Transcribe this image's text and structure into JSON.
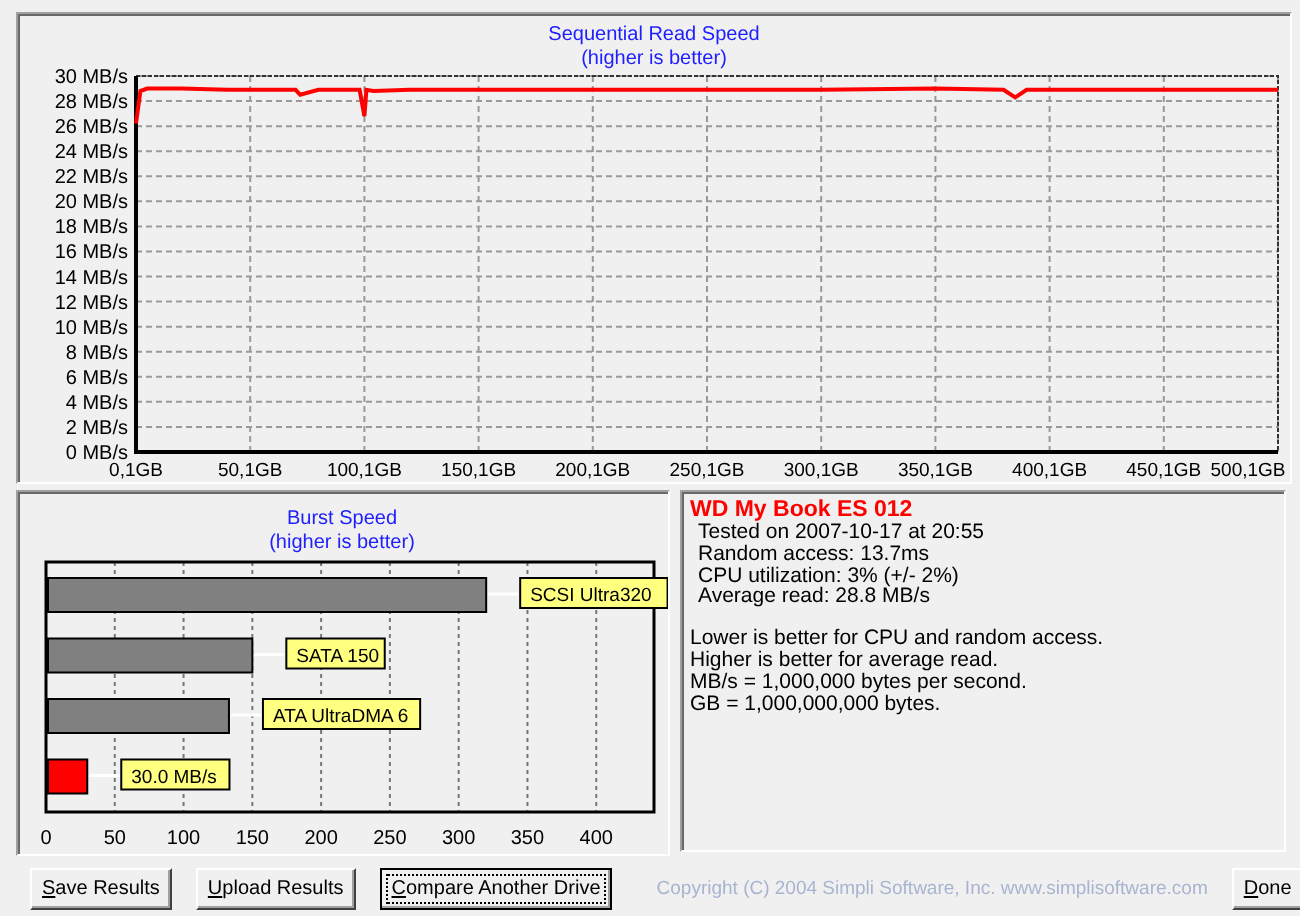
{
  "sequential": {
    "chart_data": {
      "type": "line",
      "title": "Sequential Read Speed\n(higher is better)",
      "x": [
        0.1,
        2,
        5,
        20,
        40,
        60,
        70,
        72,
        80,
        98,
        100.1,
        101,
        104,
        120,
        150,
        200,
        250,
        300,
        350,
        380,
        385,
        390,
        420,
        450,
        480,
        500.1
      ],
      "grid": true,
      "series": [
        {
          "color": "#ff0000",
          "values": [
            26.2,
            28.8,
            29.0,
            29.0,
            28.9,
            28.9,
            28.9,
            28.5,
            28.9,
            28.9,
            26.8,
            28.9,
            28.8,
            28.9,
            28.9,
            28.9,
            28.9,
            28.9,
            29.0,
            28.9,
            28.3,
            28.9,
            28.9,
            28.9,
            28.9,
            28.9
          ]
        }
      ],
      "xlim": [
        0.1,
        500.1
      ],
      "ylim": [
        0,
        30
      ],
      "xticks": [
        {
          "value": 0.1,
          "label": "0,1GB"
        },
        {
          "value": 50.1,
          "label": "50,1GB"
        },
        {
          "value": 100.1,
          "label": "100,1GB"
        },
        {
          "value": 150.1,
          "label": "150,1GB"
        },
        {
          "value": 200.1,
          "label": "200,1GB"
        },
        {
          "value": 250.1,
          "label": "250,1GB"
        },
        {
          "value": 300.1,
          "label": "300,1GB"
        },
        {
          "value": 350.1,
          "label": "350,1GB"
        },
        {
          "value": 400.1,
          "label": "400,1GB"
        },
        {
          "value": 450.1,
          "label": "450,1GB"
        },
        {
          "value": 500.1,
          "label": "500,1GB"
        }
      ],
      "yticks": [
        {
          "value": 0,
          "label": "0 MB/s"
        },
        {
          "value": 2,
          "label": "2 MB/s"
        },
        {
          "value": 4,
          "label": "4 MB/s"
        },
        {
          "value": 6,
          "label": "6 MB/s"
        },
        {
          "value": 8,
          "label": "8 MB/s"
        },
        {
          "value": 10,
          "label": "10 MB/s"
        },
        {
          "value": 12,
          "label": "12 MB/s"
        },
        {
          "value": 14,
          "label": "14 MB/s"
        },
        {
          "value": 16,
          "label": "16 MB/s"
        },
        {
          "value": 18,
          "label": "18 MB/s"
        },
        {
          "value": 20,
          "label": "20 MB/s"
        },
        {
          "value": 22,
          "label": "22 MB/s"
        },
        {
          "value": 24,
          "label": "24 MB/s"
        },
        {
          "value": 26,
          "label": "26 MB/s"
        },
        {
          "value": 28,
          "label": "28 MB/s"
        },
        {
          "value": 30,
          "label": "30 MB/s"
        }
      ]
    }
  },
  "burst": {
    "chart_data": {
      "type": "bar",
      "orientation": "horizontal",
      "title": "Burst Speed\n(higher is better)",
      "categories": [
        "SCSI Ultra320",
        "SATA 150",
        "ATA UltraDMA 6",
        "30.0 MB/s"
      ],
      "grid": true,
      "series": [
        {
          "color": "#808080",
          "values": [
            320,
            150,
            133,
            null
          ]
        },
        {
          "color": "#ff0000",
          "values": [
            null,
            null,
            null,
            30
          ]
        }
      ],
      "xlim": [
        0,
        442
      ],
      "xticks": [
        0,
        50,
        100,
        150,
        200,
        250,
        300,
        350,
        400
      ]
    }
  },
  "info": {
    "title": "WD My Book ES 012",
    "details": [
      "Tested on 2007-10-17 at 20:55",
      "Random access: 13.7ms",
      "CPU utilization: 3% (+/- 2%)",
      "Average read: 28.8 MB/s"
    ],
    "notes": [
      "Lower is better for CPU and random access.",
      "Higher is better for average read.",
      "MB/s = 1,000,000 bytes per second.",
      "GB = 1,000,000,000 bytes."
    ]
  },
  "buttons": [
    {
      "label": "Save Results",
      "focused": false
    },
    {
      "label": "Upload Results",
      "focused": false
    },
    {
      "label": "Compare Another Drive",
      "focused": true
    }
  ],
  "copyright": "Copyright (C) 2004 Simpli Software, Inc. www.simplisoftware.com",
  "done_button": {
    "label": "Done",
    "focused": false
  }
}
